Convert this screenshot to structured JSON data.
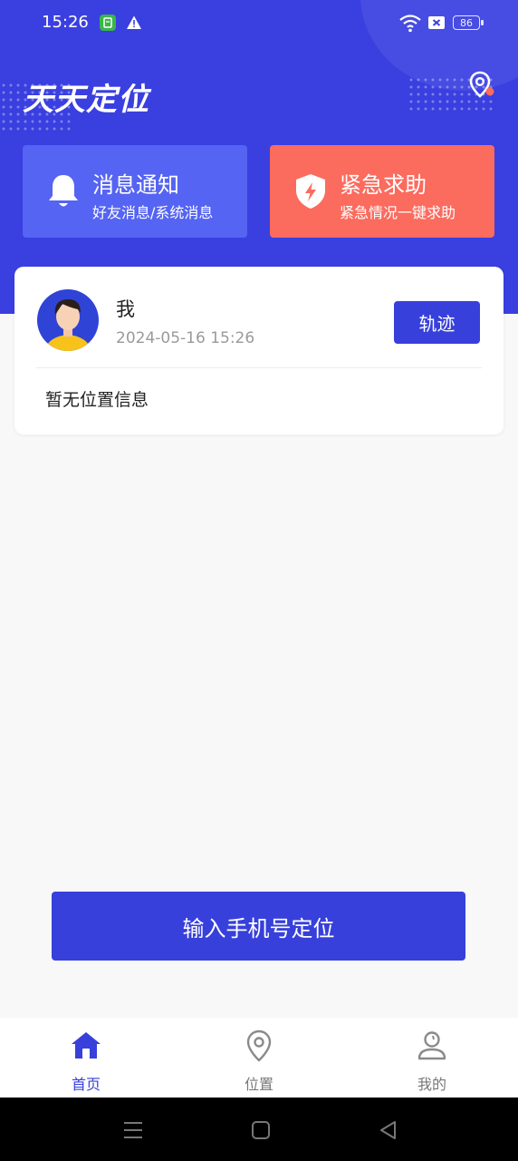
{
  "status_bar": {
    "time": "15:26",
    "battery": "86"
  },
  "header": {
    "title": "天天定位",
    "accent_color": "#3a3fe0"
  },
  "cards": {
    "message": {
      "title": "消息通知",
      "subtitle": "好友消息/系统消息",
      "icon": "bell-icon",
      "color": "#5564f2"
    },
    "emergency": {
      "title": "紧急求助",
      "subtitle": "紧急情况一键求助",
      "icon": "shield-alert-icon",
      "color": "#fb6b5e"
    }
  },
  "user_card": {
    "name": "我",
    "time": "2024-05-16 15:26",
    "track_label": "轨迹",
    "location_text": "暂无位置信息"
  },
  "main": {
    "phone_locate_label": "输入手机号定位"
  },
  "tabs": [
    {
      "label": "首页",
      "icon": "home-icon",
      "active": true
    },
    {
      "label": "位置",
      "icon": "location-pin-icon",
      "active": false
    },
    {
      "label": "我的",
      "icon": "user-icon",
      "active": false
    }
  ],
  "system_nav": [
    "menu-icon",
    "home-square-icon",
    "back-icon"
  ]
}
